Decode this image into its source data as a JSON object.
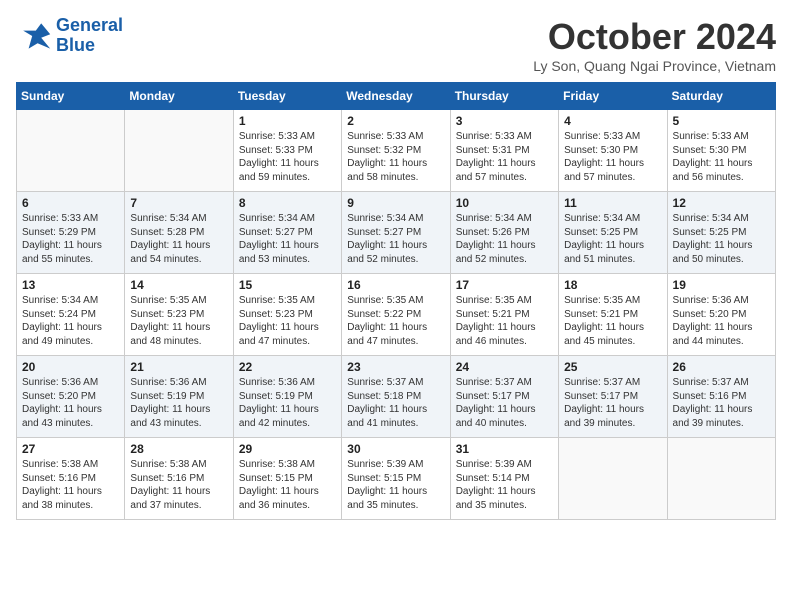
{
  "header": {
    "logo_line1": "General",
    "logo_line2": "Blue",
    "month": "October 2024",
    "location": "Ly Son, Quang Ngai Province, Vietnam"
  },
  "weekdays": [
    "Sunday",
    "Monday",
    "Tuesday",
    "Wednesday",
    "Thursday",
    "Friday",
    "Saturday"
  ],
  "weeks": [
    [
      {
        "day": "",
        "info": ""
      },
      {
        "day": "",
        "info": ""
      },
      {
        "day": "1",
        "info": "Sunrise: 5:33 AM\nSunset: 5:33 PM\nDaylight: 11 hours and 59 minutes."
      },
      {
        "day": "2",
        "info": "Sunrise: 5:33 AM\nSunset: 5:32 PM\nDaylight: 11 hours and 58 minutes."
      },
      {
        "day": "3",
        "info": "Sunrise: 5:33 AM\nSunset: 5:31 PM\nDaylight: 11 hours and 57 minutes."
      },
      {
        "day": "4",
        "info": "Sunrise: 5:33 AM\nSunset: 5:30 PM\nDaylight: 11 hours and 57 minutes."
      },
      {
        "day": "5",
        "info": "Sunrise: 5:33 AM\nSunset: 5:30 PM\nDaylight: 11 hours and 56 minutes."
      }
    ],
    [
      {
        "day": "6",
        "info": "Sunrise: 5:33 AM\nSunset: 5:29 PM\nDaylight: 11 hours and 55 minutes."
      },
      {
        "day": "7",
        "info": "Sunrise: 5:34 AM\nSunset: 5:28 PM\nDaylight: 11 hours and 54 minutes."
      },
      {
        "day": "8",
        "info": "Sunrise: 5:34 AM\nSunset: 5:27 PM\nDaylight: 11 hours and 53 minutes."
      },
      {
        "day": "9",
        "info": "Sunrise: 5:34 AM\nSunset: 5:27 PM\nDaylight: 11 hours and 52 minutes."
      },
      {
        "day": "10",
        "info": "Sunrise: 5:34 AM\nSunset: 5:26 PM\nDaylight: 11 hours and 52 minutes."
      },
      {
        "day": "11",
        "info": "Sunrise: 5:34 AM\nSunset: 5:25 PM\nDaylight: 11 hours and 51 minutes."
      },
      {
        "day": "12",
        "info": "Sunrise: 5:34 AM\nSunset: 5:25 PM\nDaylight: 11 hours and 50 minutes."
      }
    ],
    [
      {
        "day": "13",
        "info": "Sunrise: 5:34 AM\nSunset: 5:24 PM\nDaylight: 11 hours and 49 minutes."
      },
      {
        "day": "14",
        "info": "Sunrise: 5:35 AM\nSunset: 5:23 PM\nDaylight: 11 hours and 48 minutes."
      },
      {
        "day": "15",
        "info": "Sunrise: 5:35 AM\nSunset: 5:23 PM\nDaylight: 11 hours and 47 minutes."
      },
      {
        "day": "16",
        "info": "Sunrise: 5:35 AM\nSunset: 5:22 PM\nDaylight: 11 hours and 47 minutes."
      },
      {
        "day": "17",
        "info": "Sunrise: 5:35 AM\nSunset: 5:21 PM\nDaylight: 11 hours and 46 minutes."
      },
      {
        "day": "18",
        "info": "Sunrise: 5:35 AM\nSunset: 5:21 PM\nDaylight: 11 hours and 45 minutes."
      },
      {
        "day": "19",
        "info": "Sunrise: 5:36 AM\nSunset: 5:20 PM\nDaylight: 11 hours and 44 minutes."
      }
    ],
    [
      {
        "day": "20",
        "info": "Sunrise: 5:36 AM\nSunset: 5:20 PM\nDaylight: 11 hours and 43 minutes."
      },
      {
        "day": "21",
        "info": "Sunrise: 5:36 AM\nSunset: 5:19 PM\nDaylight: 11 hours and 43 minutes."
      },
      {
        "day": "22",
        "info": "Sunrise: 5:36 AM\nSunset: 5:19 PM\nDaylight: 11 hours and 42 minutes."
      },
      {
        "day": "23",
        "info": "Sunrise: 5:37 AM\nSunset: 5:18 PM\nDaylight: 11 hours and 41 minutes."
      },
      {
        "day": "24",
        "info": "Sunrise: 5:37 AM\nSunset: 5:17 PM\nDaylight: 11 hours and 40 minutes."
      },
      {
        "day": "25",
        "info": "Sunrise: 5:37 AM\nSunset: 5:17 PM\nDaylight: 11 hours and 39 minutes."
      },
      {
        "day": "26",
        "info": "Sunrise: 5:37 AM\nSunset: 5:16 PM\nDaylight: 11 hours and 39 minutes."
      }
    ],
    [
      {
        "day": "27",
        "info": "Sunrise: 5:38 AM\nSunset: 5:16 PM\nDaylight: 11 hours and 38 minutes."
      },
      {
        "day": "28",
        "info": "Sunrise: 5:38 AM\nSunset: 5:16 PM\nDaylight: 11 hours and 37 minutes."
      },
      {
        "day": "29",
        "info": "Sunrise: 5:38 AM\nSunset: 5:15 PM\nDaylight: 11 hours and 36 minutes."
      },
      {
        "day": "30",
        "info": "Sunrise: 5:39 AM\nSunset: 5:15 PM\nDaylight: 11 hours and 35 minutes."
      },
      {
        "day": "31",
        "info": "Sunrise: 5:39 AM\nSunset: 5:14 PM\nDaylight: 11 hours and 35 minutes."
      },
      {
        "day": "",
        "info": ""
      },
      {
        "day": "",
        "info": ""
      }
    ]
  ]
}
